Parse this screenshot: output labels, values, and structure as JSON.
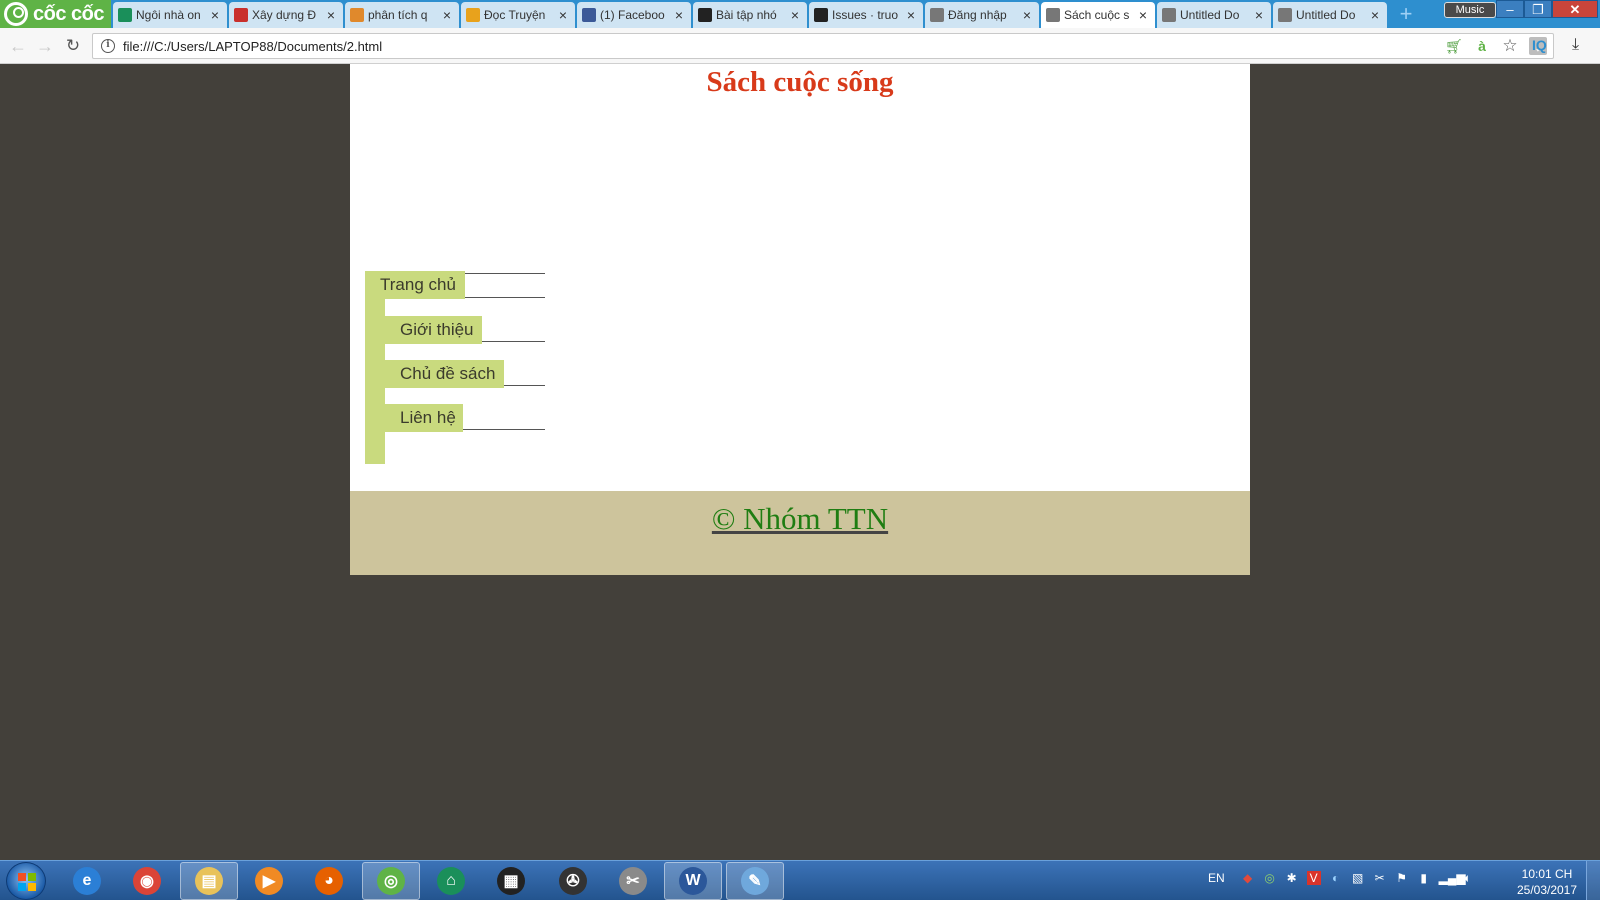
{
  "browser": {
    "brand": "cốc cốc",
    "tabs": [
      {
        "title": "Ngôi nhà on",
        "icon": "house-icon",
        "icon_color": "#1a8f5a",
        "active": false
      },
      {
        "title": "Xây dựng Đ",
        "icon": "brush-icon",
        "icon_color": "#c9302c",
        "active": false
      },
      {
        "title": "phân tích q",
        "icon": "pencil-icon",
        "icon_color": "#e0892c",
        "active": false
      },
      {
        "title": "Đọc Truyện",
        "icon": "book-icon",
        "icon_color": "#e8a21c",
        "active": false
      },
      {
        "title": "(1) Faceboo",
        "icon": "facebook-icon",
        "icon_color": "#3b5998",
        "active": false
      },
      {
        "title": "Bài tập nhó",
        "icon": "github-icon",
        "icon_color": "#222222",
        "active": false
      },
      {
        "title": "Issues · truo",
        "icon": "github-icon",
        "icon_color": "#222222",
        "active": false
      },
      {
        "title": "Đăng nhập",
        "icon": "document-icon",
        "icon_color": "#777777",
        "active": false
      },
      {
        "title": "Sách cuộc s",
        "icon": "document-icon",
        "icon_color": "#777777",
        "active": true
      },
      {
        "title": "Untitled Do",
        "icon": "document-icon",
        "icon_color": "#777777",
        "active": false
      },
      {
        "title": "Untitled Do",
        "icon": "document-icon",
        "icon_color": "#777777",
        "active": false
      }
    ],
    "music_label": "Music",
    "url": "file:///C:/Users/LAPTOP88/Documents/2.html",
    "iq_label": "IQ"
  },
  "page": {
    "title": "Sách cuộc sống",
    "menu": [
      "Trang chủ",
      "Giới thiệu",
      "Chủ đề sách",
      "Liên hệ"
    ],
    "footer": "© Nhóm TTN",
    "colors": {
      "title": "#d83a1a",
      "menu_bg": "#c9da7e",
      "footer_bg": "#cdc49c",
      "footer_link": "#1f7d12",
      "desktop_bg": "#43403a"
    }
  },
  "taskbar": {
    "apps": [
      {
        "name": "internet-explorer-icon",
        "color": "#2b7fd6",
        "glyph": "e",
        "open": false
      },
      {
        "name": "chrome-icon",
        "color": "#db4437",
        "glyph": "◉",
        "open": false
      },
      {
        "name": "file-explorer-icon",
        "color": "#e8c25a",
        "glyph": "▤",
        "open": true
      },
      {
        "name": "media-player-icon",
        "color": "#f08a24",
        "glyph": "▶",
        "open": false
      },
      {
        "name": "firefox-icon",
        "color": "#e66000",
        "glyph": "◕",
        "open": false
      },
      {
        "name": "coccoc-icon",
        "color": "#5fb346",
        "glyph": "◎",
        "open": true
      },
      {
        "name": "ngoi-nha-icon",
        "color": "#1a8f5a",
        "glyph": "⌂",
        "open": false
      },
      {
        "name": "film-icon",
        "color": "#222222",
        "glyph": "▦",
        "open": false
      },
      {
        "name": "clapper-icon",
        "color": "#333333",
        "glyph": "✇",
        "open": false
      },
      {
        "name": "snipping-tool-icon",
        "color": "#8a8a8a",
        "glyph": "✂",
        "open": false
      },
      {
        "name": "word-icon",
        "color": "#2b579a",
        "glyph": "W",
        "open": true
      },
      {
        "name": "paint-icon",
        "color": "#6fa8dc",
        "glyph": "✎",
        "open": true
      }
    ],
    "language": "EN",
    "time": "10:01 CH",
    "date": "25/03/2017"
  }
}
